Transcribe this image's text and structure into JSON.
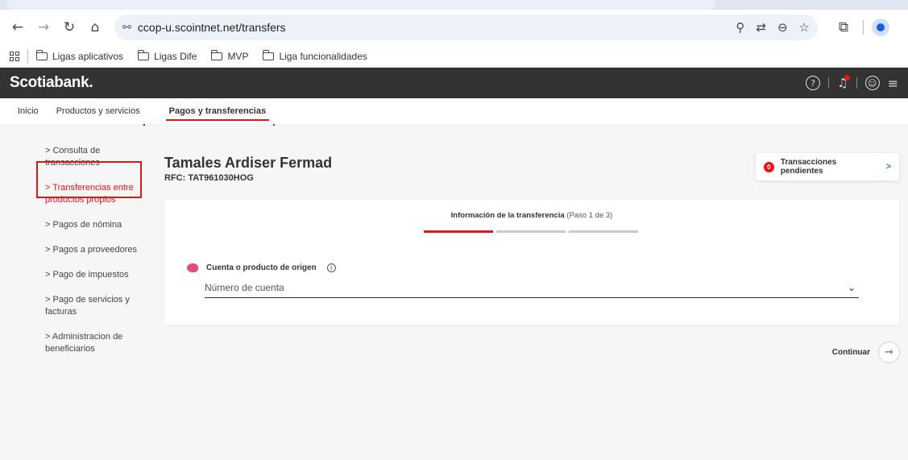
{
  "browser": {
    "url": "ccop-u.scointnet.net/transfers",
    "bookmarks": [
      "Ligas aplicativos",
      "Ligas Dife",
      "MVP",
      "Liga funcionalidades"
    ]
  },
  "header": {
    "brand": "Scotiabank."
  },
  "nav": {
    "items": [
      "Inicio",
      "Productos y servicios",
      "Pagos y transferencias"
    ],
    "active": "Pagos y transferencias"
  },
  "sidebar": {
    "items": [
      "> Consulta de transacciones",
      "> Transferencias entre productos propios",
      "> Pagos de nómina",
      "> Pagos a proveedores",
      "> Pago de impuestos",
      "> Pago de servicios y facturas",
      "> Administracion de beneficiarios"
    ],
    "active_index": 1
  },
  "client": {
    "name": "Tamales Ardiser Fermad",
    "rfc": "RFC: TAT961030HOG"
  },
  "pending": {
    "count": "0",
    "label": "Transacciones pendientes"
  },
  "form": {
    "step_title": "Información de la transferencia",
    "step_sub": "(Paso 1 de 3)",
    "progress": {
      "current": 1,
      "total": 3
    },
    "field_label": "Cuenta o producto de origen",
    "placeholder": "Número de cuenta"
  },
  "actions": {
    "continue": "Continuar"
  },
  "colors": {
    "brand_red": "#ec111a",
    "header_bg": "#333333"
  }
}
